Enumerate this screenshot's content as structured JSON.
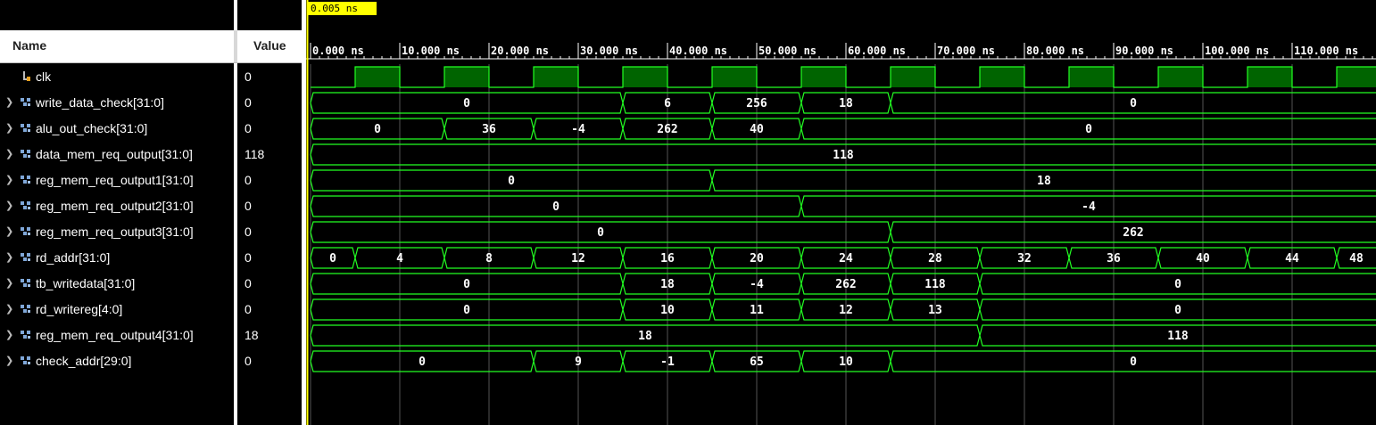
{
  "header": {
    "name_label": "Name",
    "value_label": "Value"
  },
  "cursor": {
    "label": "0.005 ns"
  },
  "timeline": {
    "ticks": [
      "0.000 ns",
      "10.000 ns",
      "20.000 ns",
      "30.000 ns",
      "40.000 ns",
      "50.000 ns",
      "60.000 ns",
      "70.000 ns",
      "80.000 ns",
      "90.000 ns",
      "100.000 ns",
      "110.000 ns"
    ]
  },
  "colors": {
    "wave": "#22ff22",
    "clk_fill": "#006400",
    "cursor": "#ffff00"
  },
  "signals": [
    {
      "name": "clk",
      "value": "0",
      "type": "clock",
      "icon": "bit-icon"
    },
    {
      "name": "write_data_check[31:0]",
      "value": "0",
      "type": "bus",
      "icon": "bus-icon",
      "segments": [
        [
          0,
          35,
          "0"
        ],
        [
          35,
          45,
          "6"
        ],
        [
          45,
          55,
          "256"
        ],
        [
          55,
          65,
          "18"
        ],
        [
          65,
          120,
          "0"
        ]
      ]
    },
    {
      "name": "alu_out_check[31:0]",
      "value": "0",
      "type": "bus",
      "icon": "bus-icon",
      "segments": [
        [
          0,
          15,
          "0"
        ],
        [
          15,
          25,
          "36"
        ],
        [
          25,
          35,
          "-4"
        ],
        [
          35,
          45,
          "262"
        ],
        [
          45,
          55,
          "40"
        ],
        [
          55,
          120,
          "0"
        ]
      ]
    },
    {
      "name": "data_mem_req_output[31:0]",
      "value": "118",
      "type": "bus",
      "icon": "bus-icon",
      "segments": [
        [
          0,
          120,
          "118"
        ]
      ]
    },
    {
      "name": "reg_mem_req_output1[31:0]",
      "value": "0",
      "type": "bus",
      "icon": "bus-icon",
      "segments": [
        [
          0,
          45,
          "0"
        ],
        [
          45,
          120,
          "18"
        ]
      ]
    },
    {
      "name": "reg_mem_req_output2[31:0]",
      "value": "0",
      "type": "bus",
      "icon": "bus-icon",
      "segments": [
        [
          0,
          55,
          "0"
        ],
        [
          55,
          120,
          "-4"
        ]
      ]
    },
    {
      "name": "reg_mem_req_output3[31:0]",
      "value": "0",
      "type": "bus",
      "icon": "bus-icon",
      "segments": [
        [
          0,
          65,
          "0"
        ],
        [
          65,
          120,
          "262"
        ]
      ]
    },
    {
      "name": "rd_addr[31:0]",
      "value": "0",
      "type": "bus",
      "icon": "bus-icon",
      "segments": [
        [
          0,
          5,
          "0"
        ],
        [
          5,
          15,
          "4"
        ],
        [
          15,
          25,
          "8"
        ],
        [
          25,
          35,
          "12"
        ],
        [
          35,
          45,
          "16"
        ],
        [
          45,
          55,
          "20"
        ],
        [
          55,
          65,
          "24"
        ],
        [
          65,
          75,
          "28"
        ],
        [
          75,
          85,
          "32"
        ],
        [
          85,
          95,
          "36"
        ],
        [
          95,
          105,
          "40"
        ],
        [
          105,
          115,
          "44"
        ],
        [
          115,
          120,
          "48"
        ]
      ]
    },
    {
      "name": "tb_writedata[31:0]",
      "value": "0",
      "type": "bus",
      "icon": "bus-icon",
      "segments": [
        [
          0,
          35,
          "0"
        ],
        [
          35,
          45,
          "18"
        ],
        [
          45,
          55,
          "-4"
        ],
        [
          55,
          65,
          "262"
        ],
        [
          65,
          75,
          "118"
        ],
        [
          75,
          120,
          "0"
        ]
      ]
    },
    {
      "name": "rd_writereg[4:0]",
      "value": "0",
      "type": "bus",
      "icon": "bus-icon",
      "segments": [
        [
          0,
          35,
          "0"
        ],
        [
          35,
          45,
          "10"
        ],
        [
          45,
          55,
          "11"
        ],
        [
          55,
          65,
          "12"
        ],
        [
          65,
          75,
          "13"
        ],
        [
          75,
          120,
          "0"
        ]
      ]
    },
    {
      "name": "reg_mem_req_output4[31:0]",
      "value": "18",
      "type": "bus",
      "icon": "bus-icon",
      "segments": [
        [
          0,
          75,
          "18"
        ],
        [
          75,
          120,
          "118"
        ]
      ]
    },
    {
      "name": "check_addr[29:0]",
      "value": "0",
      "type": "bus",
      "icon": "bus-icon",
      "segments": [
        [
          0,
          25,
          "0"
        ],
        [
          25,
          35,
          "9"
        ],
        [
          35,
          45,
          "-1"
        ],
        [
          45,
          55,
          "65"
        ],
        [
          55,
          65,
          "10"
        ],
        [
          65,
          120,
          "0"
        ]
      ]
    }
  ]
}
